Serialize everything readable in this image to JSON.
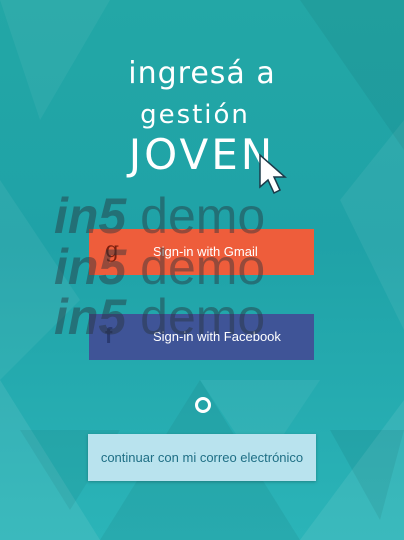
{
  "heading": {
    "line1": "ingresá a",
    "line2": "gestión",
    "line3": "JOVEN"
  },
  "buttons": {
    "gmail": {
      "label": "Sign-in with Gmail",
      "icon": "google-g-icon",
      "icon_glyph": "g",
      "color": "#ee5d3b"
    },
    "facebook": {
      "label": "Sign-in with Facebook",
      "icon": "facebook-icon",
      "icon_glyph": "f",
      "color": "#3f5497"
    },
    "email": {
      "label": "continuar con mi correo electrónico",
      "color": "#b9e3ee"
    }
  },
  "watermark": {
    "brand": "in5",
    "word": "demo"
  },
  "theme": {
    "background": "#23a7a6"
  }
}
